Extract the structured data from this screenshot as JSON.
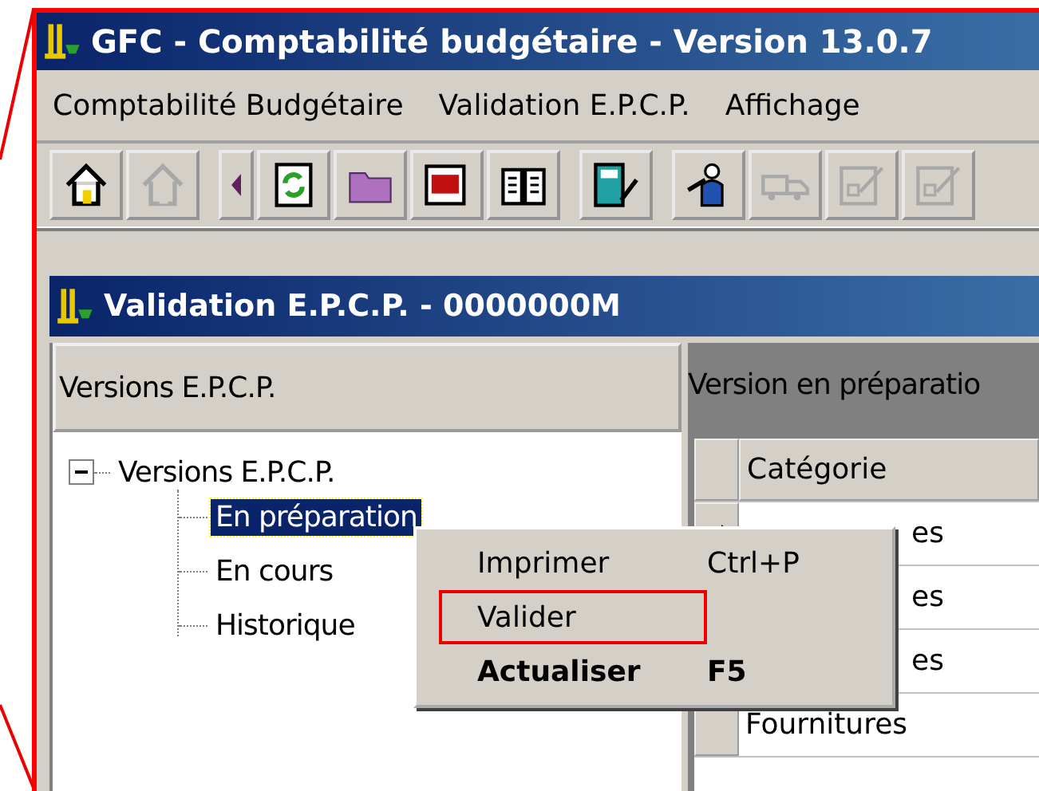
{
  "window": {
    "title": "GFC - Comptabilité budgétaire - Version 13.0.7"
  },
  "menu_bar": [
    "Comptabilité Budgétaire",
    "Validation E.P.C.P.",
    "Affichage"
  ],
  "toolbar": [
    [
      {
        "kind": "home",
        "disabled": false
      },
      {
        "kind": "home",
        "disabled": true
      }
    ],
    [
      {
        "kind": "partial",
        "disabled": false
      },
      {
        "kind": "refresh",
        "disabled": false
      },
      {
        "kind": "folder",
        "disabled": false
      },
      {
        "kind": "text",
        "disabled": false
      },
      {
        "kind": "book",
        "disabled": false
      }
    ],
    [
      {
        "kind": "calculator",
        "disabled": false
      }
    ],
    [
      {
        "kind": "person",
        "disabled": false
      },
      {
        "kind": "truck",
        "disabled": true
      },
      {
        "kind": "form",
        "disabled": true
      },
      {
        "kind": "form",
        "disabled": true
      }
    ]
  ],
  "child_window": {
    "title": "Validation E.P.C.P. - 0000000M",
    "left_panel": {
      "header": "Versions E.P.C.P.",
      "tree": [
        {
          "label": "Versions E.P.C.P.",
          "expanded": true,
          "selected": false,
          "children": [
            {
              "label": "En préparation",
              "selected": true
            },
            {
              "label": "En cours",
              "selected": false
            },
            {
              "label": "Historique",
              "selected": false
            }
          ]
        }
      ]
    },
    "right_panel": {
      "header": "Version en préparatio",
      "table": {
        "columns": [
          "Catégorie"
        ],
        "rows": [
          {
            "cell": "es",
            "current": true,
            "covered": true
          },
          {
            "cell": "es",
            "current": false,
            "covered": true
          },
          {
            "cell": "es",
            "current": false,
            "covered": true
          },
          {
            "cell": "Fournitures",
            "current": false,
            "covered": false
          }
        ]
      }
    }
  },
  "context_menu": [
    {
      "label": "Imprimer",
      "shortcut": "Ctrl+P",
      "bold": false,
      "highlighted": false
    },
    {
      "label": "Valider",
      "bold": false,
      "highlighted": true
    },
    {
      "label": "Actualiser",
      "shortcut": "F5",
      "bold": true,
      "highlighted": false
    }
  ]
}
